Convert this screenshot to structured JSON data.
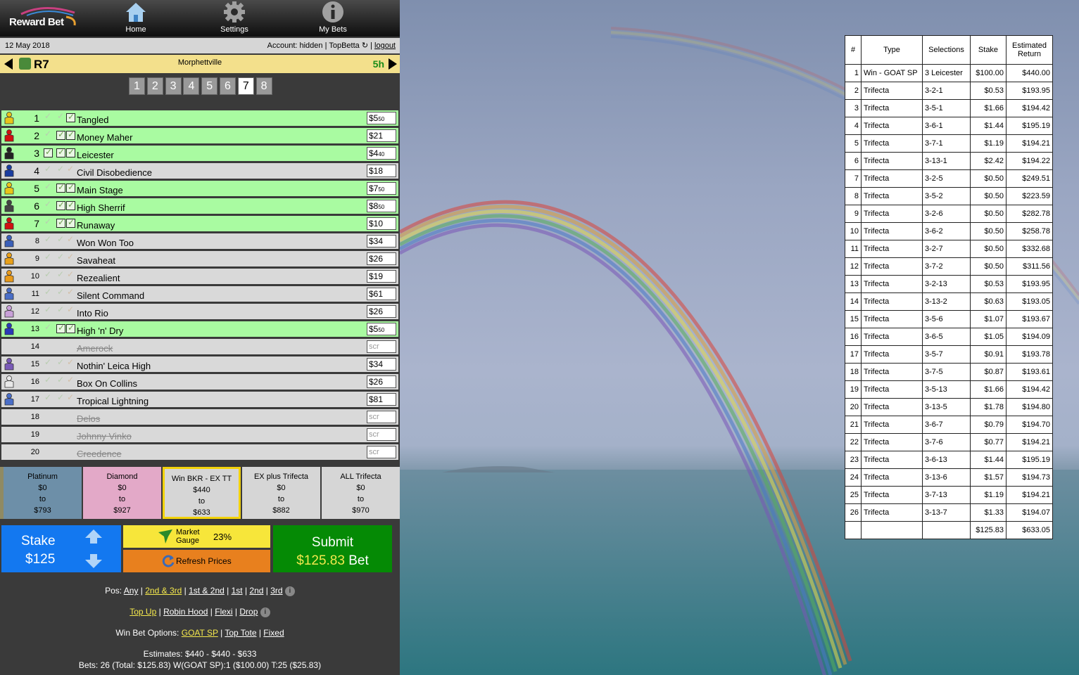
{
  "app": {
    "logo_text": "Reward Bet",
    "nav": [
      {
        "label": "Home",
        "icon": "home-icon"
      },
      {
        "label": "Settings",
        "icon": "gear-icon"
      },
      {
        "label": "My Bets",
        "icon": "info-icon"
      }
    ]
  },
  "header": {
    "date": "12 May 2018",
    "account_label": "Account:",
    "account_value": "hidden",
    "bookmaker": "TopBetta",
    "logout": "logout"
  },
  "race": {
    "number": "R7",
    "venue": "Morphettville",
    "time_to_start": "5h",
    "tabs": [
      "1",
      "2",
      "3",
      "4",
      "5",
      "6",
      "7",
      "8"
    ],
    "active_tab": "7"
  },
  "runners": [
    {
      "num": "1",
      "name": "Tangled",
      "price": "$5.50",
      "selected": true,
      "scratched": false,
      "boxes": [
        false,
        false,
        true
      ]
    },
    {
      "num": "2",
      "name": "Money Maher",
      "price": "$21",
      "selected": true,
      "scratched": false,
      "boxes": [
        false,
        true,
        true
      ]
    },
    {
      "num": "3",
      "name": "Leicester",
      "price": "$4.40",
      "selected": true,
      "scratched": false,
      "boxes": [
        true,
        true,
        true
      ]
    },
    {
      "num": "4",
      "name": "Civil Disobedience",
      "price": "$18",
      "selected": false,
      "scratched": false,
      "boxes": [
        false,
        false,
        false
      ]
    },
    {
      "num": "5",
      "name": "Main Stage",
      "price": "$7.50",
      "selected": true,
      "scratched": false,
      "boxes": [
        false,
        true,
        true
      ]
    },
    {
      "num": "6",
      "name": "High Sherrif",
      "price": "$8.50",
      "selected": true,
      "scratched": false,
      "boxes": [
        false,
        true,
        true
      ]
    },
    {
      "num": "7",
      "name": "Runaway",
      "price": "$10",
      "selected": true,
      "scratched": false,
      "boxes": [
        false,
        true,
        true
      ]
    },
    {
      "num": "8",
      "name": "Won Won Too",
      "price": "$34",
      "selected": false,
      "scratched": false,
      "boxes": [
        false,
        false,
        false
      ]
    },
    {
      "num": "9",
      "name": "Savaheat",
      "price": "$26",
      "selected": false,
      "scratched": false,
      "boxes": [
        false,
        false,
        false
      ]
    },
    {
      "num": "10",
      "name": "Rezealient",
      "price": "$19",
      "selected": false,
      "scratched": false,
      "boxes": [
        false,
        false,
        false
      ]
    },
    {
      "num": "11",
      "name": "Silent Command",
      "price": "$61",
      "selected": false,
      "scratched": false,
      "boxes": [
        false,
        false,
        false
      ]
    },
    {
      "num": "12",
      "name": "Into Rio",
      "price": "$26",
      "selected": false,
      "scratched": false,
      "boxes": [
        false,
        false,
        false
      ]
    },
    {
      "num": "13",
      "name": "High 'n' Dry",
      "price": "$5.50",
      "selected": true,
      "scratched": false,
      "boxes": [
        false,
        true,
        true
      ]
    },
    {
      "num": "14",
      "name": "Amerock",
      "price": "scr",
      "selected": false,
      "scratched": true,
      "boxes": []
    },
    {
      "num": "15",
      "name": "Nothin' Leica High",
      "price": "$34",
      "selected": false,
      "scratched": false,
      "boxes": [
        false,
        false,
        false
      ]
    },
    {
      "num": "16",
      "name": "Box On Collins",
      "price": "$26",
      "selected": false,
      "scratched": false,
      "boxes": [
        false,
        false,
        false
      ]
    },
    {
      "num": "17",
      "name": "Tropical Lightning",
      "price": "$81",
      "selected": false,
      "scratched": false,
      "boxes": [
        false,
        false,
        false
      ]
    },
    {
      "num": "18",
      "name": "Delos",
      "price": "scr",
      "selected": false,
      "scratched": true,
      "boxes": []
    },
    {
      "num": "19",
      "name": "Johnny Vinko",
      "price": "scr",
      "selected": false,
      "scratched": true,
      "boxes": []
    },
    {
      "num": "20",
      "name": "Creedence",
      "price": "scr",
      "selected": false,
      "scratched": true,
      "boxes": []
    }
  ],
  "silk_colors": [
    "#e8c51a",
    "#d01010",
    "#222222",
    "#1a3da0",
    "#e8c51a",
    "#444444",
    "#d01010",
    "#3a5fb8",
    "#e8a01a",
    "#e89a1a",
    "#4a6ec8",
    "#c8a0d8",
    "#2a3ab8",
    "",
    "#7a5ab8",
    "#e8e8e8",
    "#4a6ec8",
    "",
    "",
    ""
  ],
  "products": [
    {
      "name": "Platinum",
      "from": "$0",
      "to_label": "to",
      "to": "$793",
      "bg": "#6d8fa8",
      "selected": false
    },
    {
      "name": "Diamond",
      "from": "$0",
      "to_label": "to",
      "to": "$927",
      "bg": "#e3a9c8",
      "selected": false
    },
    {
      "name": "Win BKR - EX TT",
      "from": "$440",
      "to_label": "to",
      "to": "$633",
      "bg": "#d6d6d6",
      "selected": true
    },
    {
      "name": "EX plus Trifecta",
      "from": "$0",
      "to_label": "to",
      "to": "$882",
      "bg": "#d6d6d6",
      "selected": false
    },
    {
      "name": "ALL Trifecta",
      "from": "$0",
      "to_label": "to",
      "to": "$970",
      "bg": "#d6d6d6",
      "selected": false
    }
  ],
  "actions": {
    "stake_label": "Stake",
    "stake_value": "$125",
    "gauge_label_1": "Market",
    "gauge_label_2": "Gauge",
    "gauge_value": "23%",
    "refresh_label": "Refresh Prices",
    "submit_label": "Submit",
    "submit_amount": "$125.83",
    "submit_suffix": "Bet"
  },
  "options": {
    "pos_label": "Pos:",
    "pos_links": [
      "Any",
      "2nd & 3rd",
      "1st & 2nd",
      "1st",
      "2nd",
      "3rd"
    ],
    "pos_active": "2nd & 3rd",
    "mode_links": [
      "Top Up",
      "Robin Hood",
      "Flexi",
      "Drop"
    ],
    "mode_active": "Top Up",
    "win_label": "Win Bet Options:",
    "win_links": [
      "GOAT SP",
      "Top Tote",
      "Fixed"
    ],
    "win_active": "GOAT SP",
    "estimates": "Estimates: $440 - $440 - $633",
    "bets_summary": "Bets: 26 (Total: $125.83) W(GOAT SP):1 ($100.00) T:25 ($25.83)"
  },
  "bets_table": {
    "headers": [
      "#",
      "Type",
      "Selections",
      "Stake",
      "Estimated Return"
    ],
    "rows": [
      [
        "1",
        "Win - GOAT SP",
        "3 Leicester",
        "$100.00",
        "$440.00"
      ],
      [
        "2",
        "Trifecta",
        "3-2-1",
        "$0.53",
        "$193.95"
      ],
      [
        "3",
        "Trifecta",
        "3-5-1",
        "$1.66",
        "$194.42"
      ],
      [
        "4",
        "Trifecta",
        "3-6-1",
        "$1.44",
        "$195.19"
      ],
      [
        "5",
        "Trifecta",
        "3-7-1",
        "$1.19",
        "$194.21"
      ],
      [
        "6",
        "Trifecta",
        "3-13-1",
        "$2.42",
        "$194.22"
      ],
      [
        "7",
        "Trifecta",
        "3-2-5",
        "$0.50",
        "$249.51"
      ],
      [
        "8",
        "Trifecta",
        "3-5-2",
        "$0.50",
        "$223.59"
      ],
      [
        "9",
        "Trifecta",
        "3-2-6",
        "$0.50",
        "$282.78"
      ],
      [
        "10",
        "Trifecta",
        "3-6-2",
        "$0.50",
        "$258.78"
      ],
      [
        "11",
        "Trifecta",
        "3-2-7",
        "$0.50",
        "$332.68"
      ],
      [
        "12",
        "Trifecta",
        "3-7-2",
        "$0.50",
        "$311.56"
      ],
      [
        "13",
        "Trifecta",
        "3-2-13",
        "$0.53",
        "$193.95"
      ],
      [
        "14",
        "Trifecta",
        "3-13-2",
        "$0.63",
        "$193.05"
      ],
      [
        "15",
        "Trifecta",
        "3-5-6",
        "$1.07",
        "$193.67"
      ],
      [
        "16",
        "Trifecta",
        "3-6-5",
        "$1.05",
        "$194.09"
      ],
      [
        "17",
        "Trifecta",
        "3-5-7",
        "$0.91",
        "$193.78"
      ],
      [
        "18",
        "Trifecta",
        "3-7-5",
        "$0.87",
        "$193.61"
      ],
      [
        "19",
        "Trifecta",
        "3-5-13",
        "$1.66",
        "$194.42"
      ],
      [
        "20",
        "Trifecta",
        "3-13-5",
        "$1.78",
        "$194.80"
      ],
      [
        "21",
        "Trifecta",
        "3-6-7",
        "$0.79",
        "$194.70"
      ],
      [
        "22",
        "Trifecta",
        "3-7-6",
        "$0.77",
        "$194.21"
      ],
      [
        "23",
        "Trifecta",
        "3-6-13",
        "$1.44",
        "$195.19"
      ],
      [
        "24",
        "Trifecta",
        "3-13-6",
        "$1.57",
        "$194.73"
      ],
      [
        "25",
        "Trifecta",
        "3-7-13",
        "$1.19",
        "$194.21"
      ],
      [
        "26",
        "Trifecta",
        "3-13-7",
        "$1.33",
        "$194.07"
      ]
    ],
    "totals": [
      "",
      "",
      "",
      "$125.83",
      "$633.05"
    ]
  }
}
